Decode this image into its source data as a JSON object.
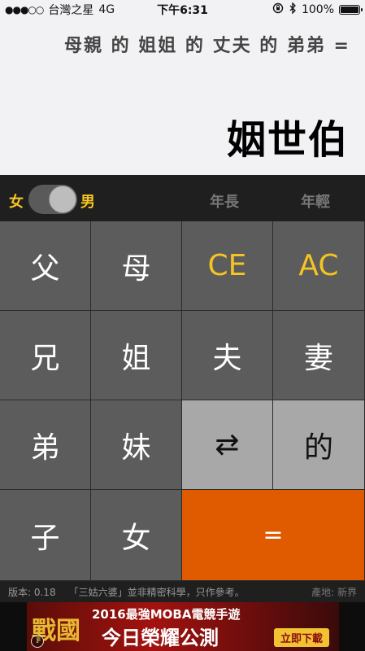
{
  "status_bar": {
    "signal": "●●●○○",
    "carrier": "台灣之星",
    "network": "4G",
    "time": "下午6:31",
    "icons": [
      "lock-rotation-icon",
      "bluetooth-icon"
    ],
    "battery_text": "100%",
    "battery_level": 1.0
  },
  "display": {
    "expression": "母親 的 姐姐 的 丈夫 的 弟弟 =",
    "result": "姻世伯"
  },
  "options": {
    "female_label": "女",
    "male_label": "男",
    "gender_selected": "男",
    "older_label": "年長",
    "younger_label": "年輕"
  },
  "keypad": {
    "father": "父",
    "mother": "母",
    "ce": "CE",
    "ac": "AC",
    "elder_brother": "兄",
    "elder_sister": "姐",
    "husband": "夫",
    "wife": "妻",
    "younger_brother": "弟",
    "younger_sister": "妹",
    "swap": "⇄",
    "of": "的",
    "son": "子",
    "daughter": "女",
    "equals": "="
  },
  "footer": {
    "version": "版本: 0.18",
    "disclaimer": "「三姑六婆」並非精密科學，只作參考。",
    "origin": "產地: 新界"
  },
  "ad": {
    "game_logo": "戰國",
    "line1": "2016最強MOBA電競手遊",
    "line2": "今日榮耀公測",
    "cta": "立即下載",
    "info": "i"
  },
  "colors": {
    "accent_yellow": "#f5c421",
    "equals_orange": "#e05a00",
    "key_dark": "#5c5c5c",
    "key_light": "#a8a8a8"
  }
}
